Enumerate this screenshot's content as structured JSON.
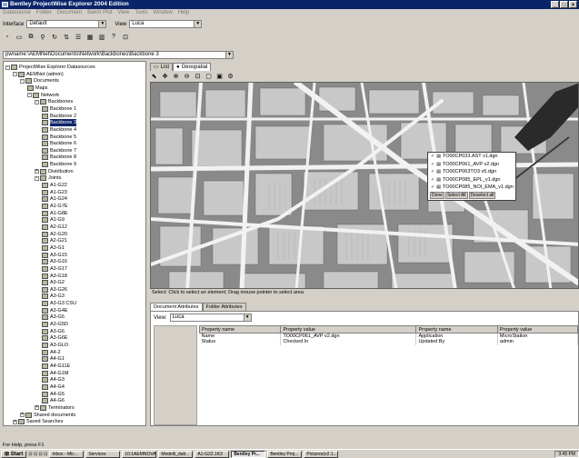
{
  "window": {
    "title": "Bentley ProjectWise Explorer 2004 Edition"
  },
  "menu": [
    "Datasource",
    "Folder",
    "Document",
    "Batch Plot",
    "View",
    "Tools",
    "Window",
    "Help"
  ],
  "toolbar": {
    "interface_label": "Interface",
    "interface_value": "Default",
    "view_label": "View",
    "view_value": "Luca"
  },
  "path": "pwname:\\AEMNet\\Documents\\Network\\Backbones\\Backbone 3",
  "tree": [
    {
      "label": "ProjectWise Explorer Datasources",
      "level": 0,
      "box": "-"
    },
    {
      "label": "AEMNet (admin)",
      "level": 1,
      "box": "-"
    },
    {
      "label": "Documents",
      "level": 2,
      "box": "-"
    },
    {
      "label": "Maps",
      "level": 3,
      "box": ""
    },
    {
      "label": "Network",
      "level": 3,
      "box": "-"
    },
    {
      "label": "Backbones",
      "level": 4,
      "box": "-"
    },
    {
      "label": "Backbone 1",
      "level": 5,
      "box": ""
    },
    {
      "label": "Backbone 2",
      "level": 5,
      "box": ""
    },
    {
      "label": "Backbone 3",
      "level": 5,
      "box": "",
      "selected": true
    },
    {
      "label": "Backbone 4",
      "level": 5,
      "box": ""
    },
    {
      "label": "Backbone 5",
      "level": 5,
      "box": ""
    },
    {
      "label": "Backbone 6",
      "level": 5,
      "box": ""
    },
    {
      "label": "Backbone 7",
      "level": 5,
      "box": ""
    },
    {
      "label": "Backbone 8",
      "level": 5,
      "box": ""
    },
    {
      "label": "Backbone 9",
      "level": 5,
      "box": ""
    },
    {
      "label": "Distribution",
      "level": 4,
      "box": "+"
    },
    {
      "label": "Joints",
      "level": 4,
      "box": "-"
    },
    {
      "label": "A1-G22",
      "level": 5,
      "box": ""
    },
    {
      "label": "A1-G23",
      "level": 5,
      "box": ""
    },
    {
      "label": "A1-G24",
      "level": 5,
      "box": ""
    },
    {
      "label": "A1-G7E",
      "level": 5,
      "box": ""
    },
    {
      "label": "A1-G8E",
      "level": 5,
      "box": ""
    },
    {
      "label": "A1-G9",
      "level": 5,
      "box": ""
    },
    {
      "label": "A2-G12",
      "level": 5,
      "box": ""
    },
    {
      "label": "A2-G20",
      "level": 5,
      "box": ""
    },
    {
      "label": "A2-G21",
      "level": 5,
      "box": ""
    },
    {
      "label": "A3-G1",
      "level": 5,
      "box": ""
    },
    {
      "label": "A3-G15",
      "level": 5,
      "box": ""
    },
    {
      "label": "A3-G16",
      "level": 5,
      "box": ""
    },
    {
      "label": "A3-G17",
      "level": 5,
      "box": ""
    },
    {
      "label": "A3-G18",
      "level": 5,
      "box": ""
    },
    {
      "label": "A3-G2",
      "level": 5,
      "box": ""
    },
    {
      "label": "A3-G26",
      "level": 5,
      "box": ""
    },
    {
      "label": "A3-G3",
      "level": 5,
      "box": ""
    },
    {
      "label": "A3-G3 CSU",
      "level": 5,
      "box": ""
    },
    {
      "label": "A3-G4E",
      "level": 5,
      "box": ""
    },
    {
      "label": "A3-G5",
      "level": 5,
      "box": ""
    },
    {
      "label": "A3-G5D",
      "level": 5,
      "box": ""
    },
    {
      "label": "A3-G6",
      "level": 5,
      "box": ""
    },
    {
      "label": "A3-G6E",
      "level": 5,
      "box": ""
    },
    {
      "label": "A3-GLO",
      "level": 5,
      "box": ""
    },
    {
      "label": "A4-2",
      "level": 5,
      "box": ""
    },
    {
      "label": "A4-G1",
      "level": 5,
      "box": ""
    },
    {
      "label": "A4-G11E",
      "level": 5,
      "box": ""
    },
    {
      "label": "A4-G1M",
      "level": 5,
      "box": ""
    },
    {
      "label": "A4-G3",
      "level": 5,
      "box": ""
    },
    {
      "label": "A4-G4",
      "level": 5,
      "box": ""
    },
    {
      "label": "A4-G5",
      "level": 5,
      "box": ""
    },
    {
      "label": "A4-G6",
      "level": 5,
      "box": ""
    },
    {
      "label": "Terminators",
      "level": 4,
      "box": "+"
    },
    {
      "label": "Shared documents",
      "level": 2,
      "box": "+"
    },
    {
      "label": "Saved Searches",
      "level": 1,
      "box": "+"
    }
  ],
  "tabs": {
    "list": "List",
    "geo": "Geospatial"
  },
  "popup": {
    "files": [
      "TO00CP033.AST v1.dgn",
      "TO00CP061_AVP v2.dgn",
      "TO00CP063TO3 v5.dgn",
      "TO00CP085_EPL_v1.dgn",
      "TO00CP085_NOI_EMA_v1.dgn"
    ],
    "buttons": [
      "Done",
      "Select All",
      "Deselect all"
    ]
  },
  "map_status": "Select: Click to select an element; Drag mouse pointer to select area",
  "attr_tabs": {
    "doc": "Document Attributes",
    "folder": "Folder Attributes"
  },
  "attr_view": {
    "label": "View:",
    "value": "Luca"
  },
  "attr_table": {
    "headers": [
      "Property name",
      "Property value",
      "Property name",
      "Property value"
    ],
    "rows": [
      [
        "Name",
        "TO00CP061_AVP v2.dgn",
        "Application",
        "MicroStation"
      ],
      [
        "Status",
        "Checked In",
        "Updated By",
        "admin"
      ]
    ]
  },
  "statusbar": "For Help, press F1",
  "taskbar": {
    "start": "Start",
    "tasks": [
      "Inbox - Mic...",
      "Services",
      "10:1AEMNOVA...",
      "Modelli_dati...",
      "A1-G22.1K3",
      "Bentley Pr...",
      "Bentley Proj...",
      "Pictures(v2.1..."
    ],
    "active_index": 5,
    "clock": "3:45 PM"
  },
  "colors": {
    "titlebar": "#0a246a",
    "face": "#d4d0c8",
    "map": "#8a8a8a",
    "road": "#f2f2f2",
    "block": "#c8c8c8"
  }
}
